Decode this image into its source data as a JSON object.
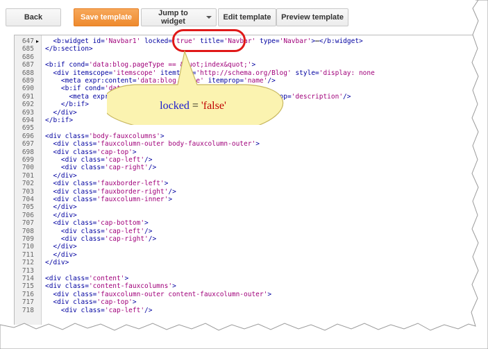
{
  "toolbar": {
    "back_label": "Back",
    "save_label": "Save template",
    "jump_label": "Jump to widget",
    "edit_label": "Edit template",
    "preview_label": "Preview template"
  },
  "editor": {
    "lines": [
      {
        "num": "647",
        "fold": "▸",
        "html": "  <span class=\"tag\">&lt;b:widget</span> <span class=\"attr\">id=</span><span class=\"str\">'Navbar1'</span> <span class=\"attr\">locked=</span><span class=\"str\">'true'</span> <span class=\"attr\">title=</span><span class=\"str\">'Navbar'</span> <span class=\"attr\">type=</span><span class=\"str\">'Navbar'</span><span class=\"tag\">&gt;</span>⋯<span class=\"tag\">&lt;/b:widget&gt;</span>"
      },
      {
        "num": "685",
        "fold": "",
        "html": "<span class=\"tag\">&lt;/b:section&gt;</span>"
      },
      {
        "num": "686",
        "fold": "",
        "html": ""
      },
      {
        "num": "687",
        "fold": "",
        "html": "<span class=\"tag\">&lt;b:if</span> <span class=\"attr\">cond=</span><span class=\"str\">'data:blog.pageType == &amp;quot;index&amp;quot;'</span><span class=\"tag\">&gt;</span>"
      },
      {
        "num": "688",
        "fold": "",
        "html": "  <span class=\"tag\">&lt;div</span> <span class=\"attr\">itemscope=</span><span class=\"str\">'itemscope'</span> <span class=\"attr\">itemtype=</span><span class=\"str\">'http://schema.org/Blog'</span> <span class=\"attr\">style=</span><span class=\"str\">'display: none</span>"
      },
      {
        "num": "689",
        "fold": "",
        "html": "    <span class=\"tag\">&lt;meta</span> <span class=\"attr\">expr:content=</span><span class=\"str\">'data:blog.title'</span> <span class=\"attr\">itemprop=</span><span class=\"str\">'name'</span><span class=\"tag\">/&gt;</span>"
      },
      {
        "num": "690",
        "fold": "",
        "html": "    <span class=\"tag\">&lt;b:if</span> <span class=\"attr\">cond=</span><span class=\"str\">'data:blog.metaDescription'</span><span class=\"tag\">&gt;</span>"
      },
      {
        "num": "691",
        "fold": "",
        "html": "      <span class=\"tag\">&lt;meta</span> <span class=\"attr\">expr:content=</span><span class=\"str\">'data:blog.metaDescription'</span> <span class=\"attr\">itemprop=</span><span class=\"str\">'description'</span><span class=\"tag\">/&gt;</span>"
      },
      {
        "num": "692",
        "fold": "",
        "html": "    <span class=\"tag\">&lt;/b:if&gt;</span>"
      },
      {
        "num": "693",
        "fold": "",
        "html": "  <span class=\"tag\">&lt;/div&gt;</span>"
      },
      {
        "num": "694",
        "fold": "",
        "html": "<span class=\"tag\">&lt;/b:if&gt;</span>"
      },
      {
        "num": "695",
        "fold": "",
        "html": ""
      },
      {
        "num": "696",
        "fold": "",
        "html": "<span class=\"tag\">&lt;div</span> <span class=\"attr\">class=</span><span class=\"str\">'body-fauxcolumns'</span><span class=\"tag\">&gt;</span>"
      },
      {
        "num": "697",
        "fold": "",
        "html": "  <span class=\"tag\">&lt;div</span> <span class=\"attr\">class=</span><span class=\"str\">'fauxcolumn-outer body-fauxcolumn-outer'</span><span class=\"tag\">&gt;</span>"
      },
      {
        "num": "698",
        "fold": "",
        "html": "  <span class=\"tag\">&lt;div</span> <span class=\"attr\">class=</span><span class=\"str\">'cap-top'</span><span class=\"tag\">&gt;</span>"
      },
      {
        "num": "699",
        "fold": "",
        "html": "    <span class=\"tag\">&lt;div</span> <span class=\"attr\">class=</span><span class=\"str\">'cap-left'</span><span class=\"tag\">/&gt;</span>"
      },
      {
        "num": "700",
        "fold": "",
        "html": "    <span class=\"tag\">&lt;div</span> <span class=\"attr\">class=</span><span class=\"str\">'cap-right'</span><span class=\"tag\">/&gt;</span>"
      },
      {
        "num": "701",
        "fold": "",
        "html": "  <span class=\"tag\">&lt;/div&gt;</span>"
      },
      {
        "num": "702",
        "fold": "",
        "html": "  <span class=\"tag\">&lt;div</span> <span class=\"attr\">class=</span><span class=\"str\">'fauxborder-left'</span><span class=\"tag\">&gt;</span>"
      },
      {
        "num": "703",
        "fold": "",
        "html": "  <span class=\"tag\">&lt;div</span> <span class=\"attr\">class=</span><span class=\"str\">'fauxborder-right'</span><span class=\"tag\">/&gt;</span>"
      },
      {
        "num": "704",
        "fold": "",
        "html": "  <span class=\"tag\">&lt;div</span> <span class=\"attr\">class=</span><span class=\"str\">'fauxcolumn-inner'</span><span class=\"tag\">&gt;</span>"
      },
      {
        "num": "705",
        "fold": "",
        "html": "  <span class=\"tag\">&lt;/div&gt;</span>"
      },
      {
        "num": "706",
        "fold": "",
        "html": "  <span class=\"tag\">&lt;/div&gt;</span>"
      },
      {
        "num": "707",
        "fold": "",
        "html": "  <span class=\"tag\">&lt;div</span> <span class=\"attr\">class=</span><span class=\"str\">'cap-bottom'</span><span class=\"tag\">&gt;</span>"
      },
      {
        "num": "708",
        "fold": "",
        "html": "    <span class=\"tag\">&lt;div</span> <span class=\"attr\">class=</span><span class=\"str\">'cap-left'</span><span class=\"tag\">/&gt;</span>"
      },
      {
        "num": "709",
        "fold": "",
        "html": "    <span class=\"tag\">&lt;div</span> <span class=\"attr\">class=</span><span class=\"str\">'cap-right'</span><span class=\"tag\">/&gt;</span>"
      },
      {
        "num": "710",
        "fold": "",
        "html": "  <span class=\"tag\">&lt;/div&gt;</span>"
      },
      {
        "num": "711",
        "fold": "",
        "html": "  <span class=\"tag\">&lt;/div&gt;</span>"
      },
      {
        "num": "712",
        "fold": "",
        "html": "<span class=\"tag\">&lt;/div&gt;</span>"
      },
      {
        "num": "713",
        "fold": "",
        "html": ""
      },
      {
        "num": "714",
        "fold": "",
        "html": "<span class=\"tag\">&lt;div</span> <span class=\"attr\">class=</span><span class=\"str\">'content'</span><span class=\"tag\">&gt;</span>"
      },
      {
        "num": "715",
        "fold": "",
        "html": "<span class=\"tag\">&lt;div</span> <span class=\"attr\">class=</span><span class=\"str\">'content-fauxcolumns'</span><span class=\"tag\">&gt;</span>"
      },
      {
        "num": "716",
        "fold": "",
        "html": "  <span class=\"tag\">&lt;div</span> <span class=\"attr\">class=</span><span class=\"str\">'fauxcolumn-outer content-fauxcolumn-outer'</span><span class=\"tag\">&gt;</span>"
      },
      {
        "num": "717",
        "fold": "",
        "html": "  <span class=\"tag\">&lt;div</span> <span class=\"attr\">class=</span><span class=\"str\">'cap-top'</span><span class=\"tag\">&gt;</span>"
      },
      {
        "num": "718",
        "fold": "",
        "html": "    <span class=\"tag\">&lt;div</span> <span class=\"attr\">class=</span><span class=\"str\">'cap-left'</span><span class=\"tag\">/&gt;</span>"
      }
    ]
  },
  "callout": {
    "keyword": "locked",
    "operator": " = ",
    "value": "'false'",
    "fill": "#fbf3b0",
    "keyword_color": "#1a1ad0",
    "value_color": "#c00000",
    "ring_color": "#e01818"
  }
}
